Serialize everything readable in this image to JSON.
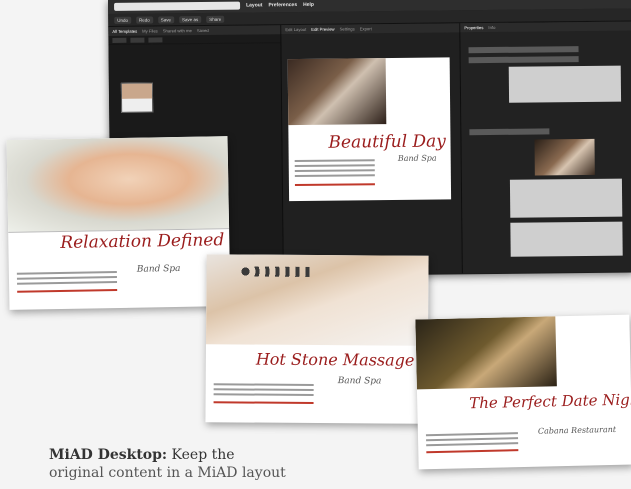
{
  "app": {
    "menu": [
      "Layout",
      "Preferences",
      "Help"
    ],
    "search_placeholder": "",
    "toolbar_buttons": [
      "Undo",
      "Redo",
      "Save",
      "Save as",
      "Share"
    ],
    "left_tabs": [
      "All Templates",
      "My Files",
      "Shared with me",
      "Saved"
    ],
    "mid_tabs": [
      "Edit Layout",
      "Edit Preview",
      "Settings",
      "Export"
    ],
    "right_tabs": [
      "Properties",
      "Info"
    ]
  },
  "editor_doc": {
    "title": "Beautiful Day",
    "signature": "Band Spa"
  },
  "cards": [
    {
      "title": "Relaxation Defined",
      "brand": "Band Spa"
    },
    {
      "title": "Hot Stone Massage",
      "brand": "Band Spa"
    },
    {
      "title": "The Perfect Date Night",
      "brand": "Cabana Restaurant"
    }
  ],
  "caption": {
    "bold": "MiAD Desktop:",
    "line1": " Keep the",
    "line2": "original content in a MiAD layout"
  }
}
